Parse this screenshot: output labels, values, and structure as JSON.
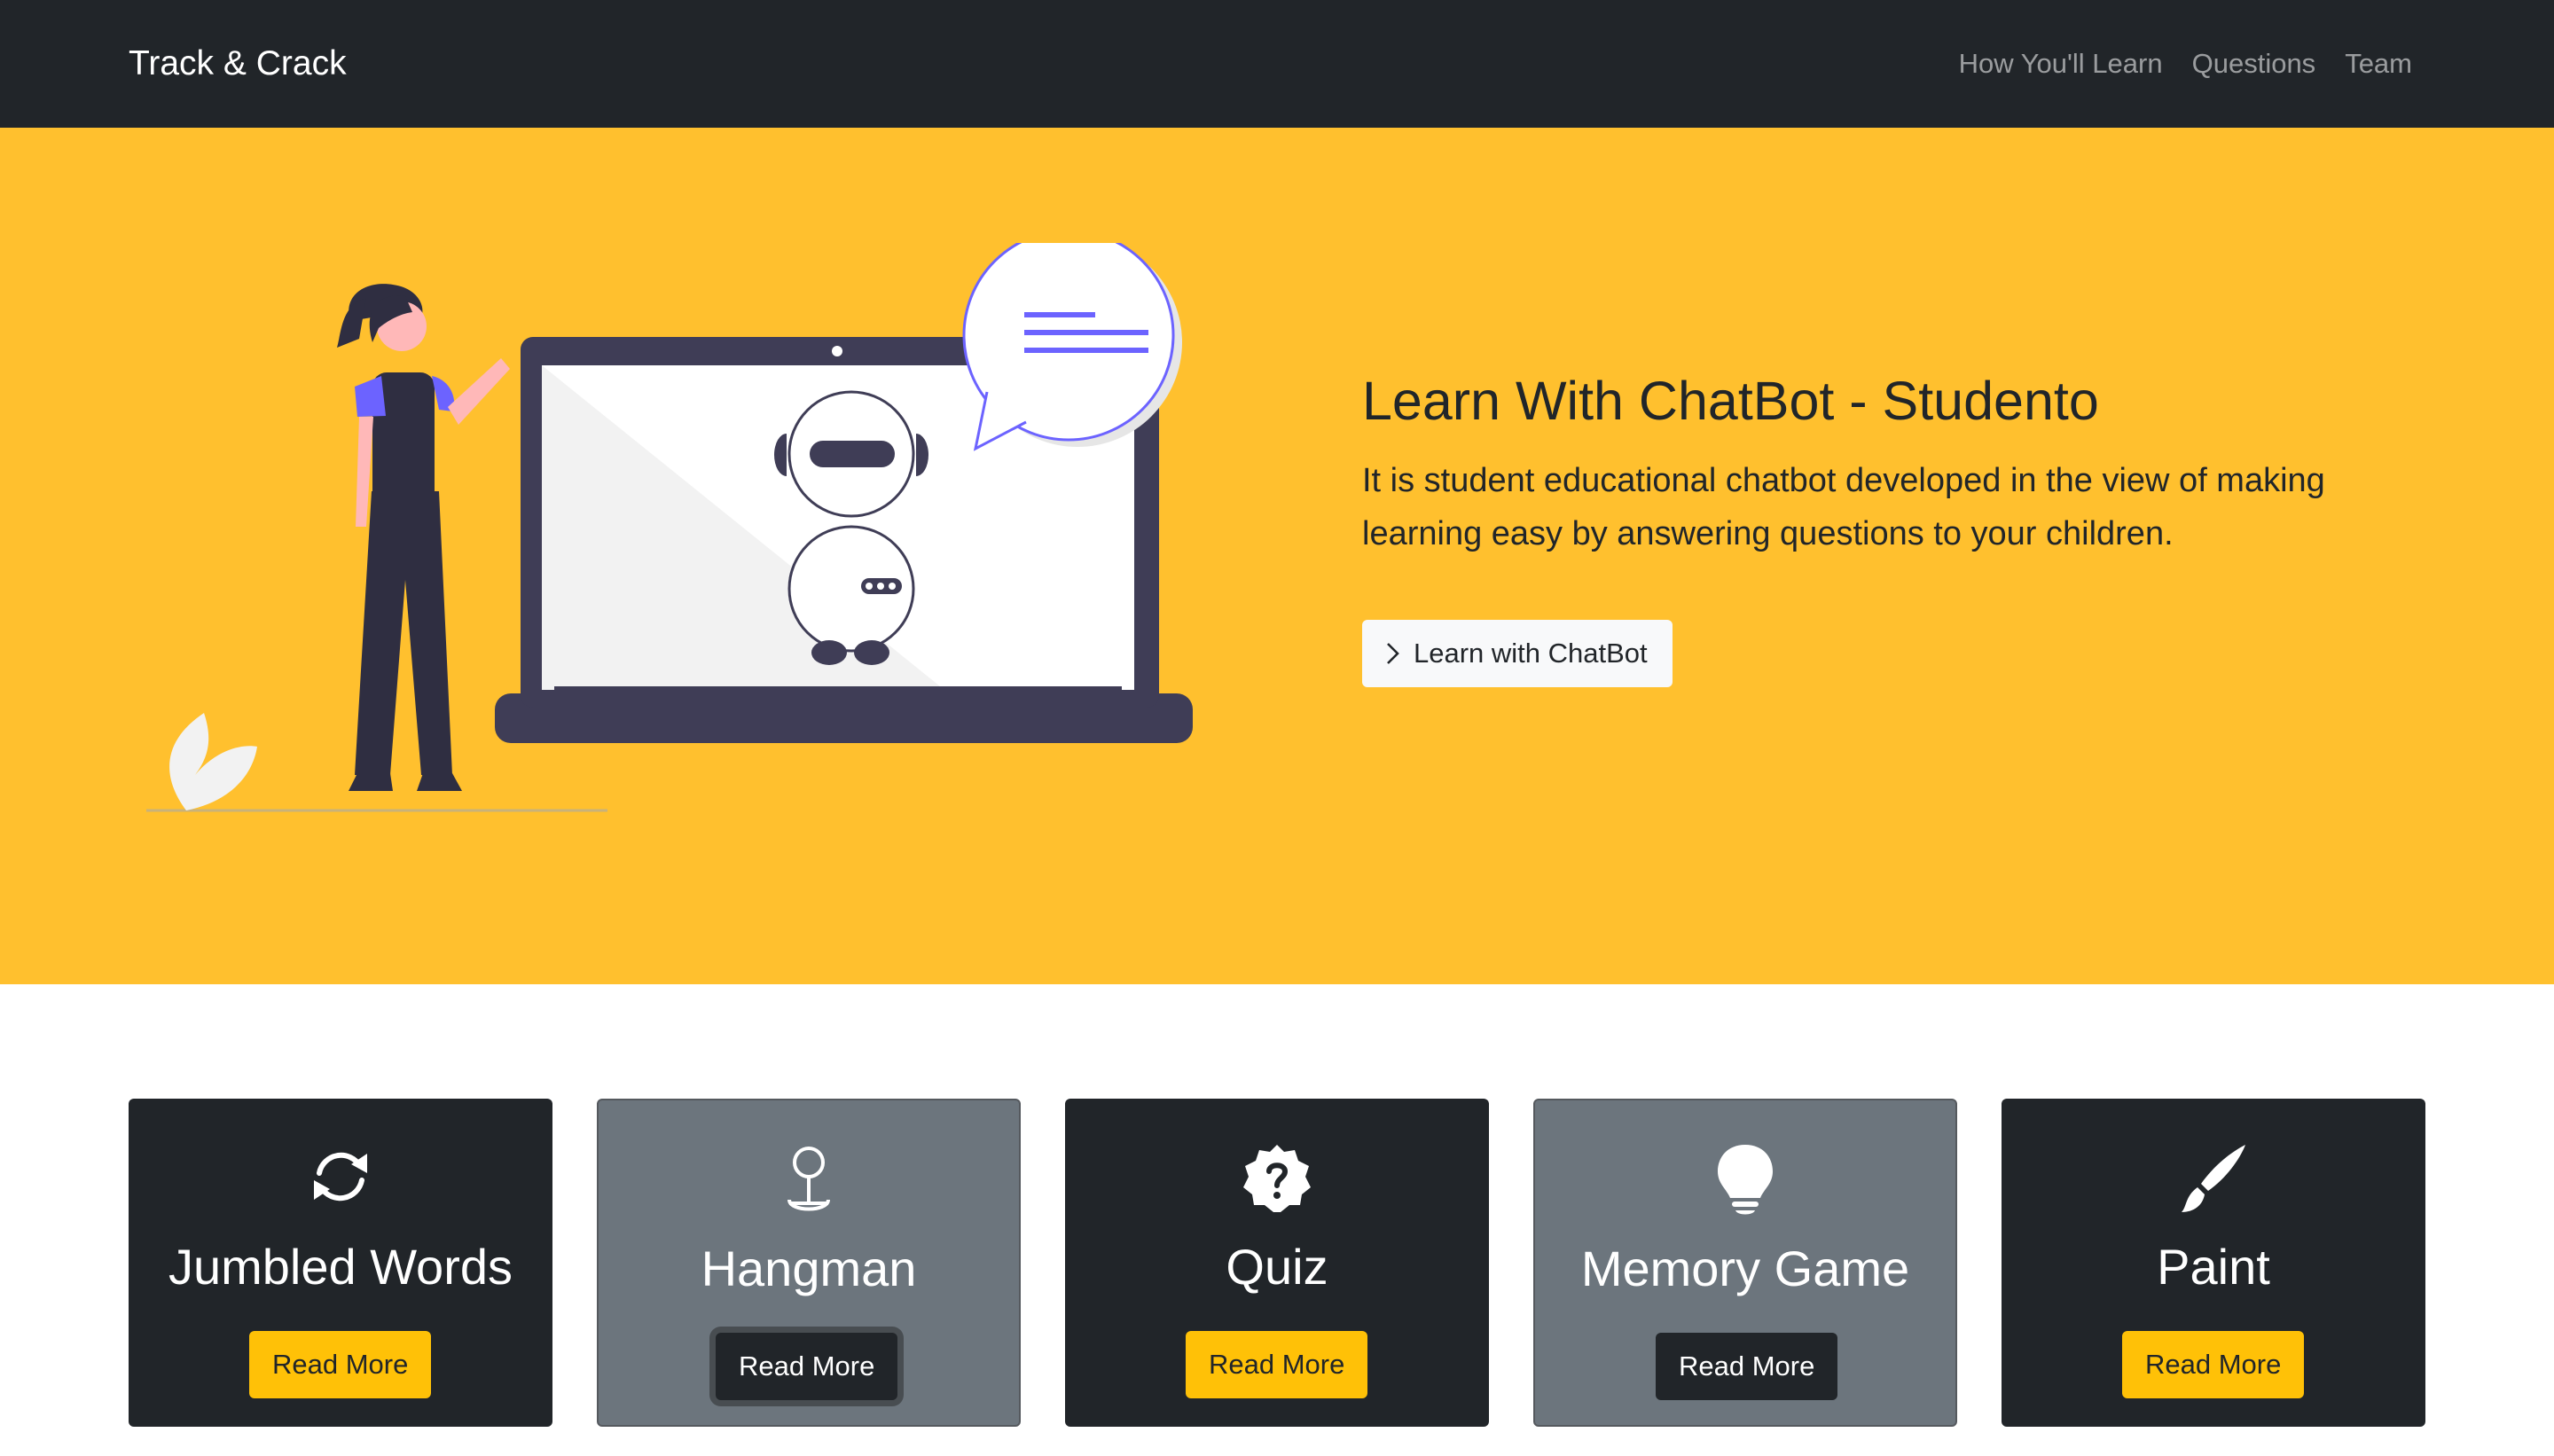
{
  "navbar": {
    "brand": "Track & Crack",
    "links": [
      "How You'll Learn",
      "Questions",
      "Team"
    ]
  },
  "hero": {
    "title": "Learn With ChatBot - Studento",
    "lead": "It is student educational chatbot developed in the view of making learning easy by answering questions to your children.",
    "button_label": "Learn with ChatBot",
    "background_color": "#ffc02e"
  },
  "cards": [
    {
      "title": "Jumbled Words",
      "button_label": "Read More",
      "icon": "refresh-icon",
      "theme": "dark",
      "button_style": "yellow"
    },
    {
      "title": "Hangman",
      "button_label": "Read More",
      "icon": "pin-icon",
      "theme": "gray",
      "button_style": "black"
    },
    {
      "title": "Quiz",
      "button_label": "Read More",
      "icon": "question-badge-icon",
      "theme": "dark",
      "button_style": "yellow"
    },
    {
      "title": "Memory Game",
      "button_label": "Read More",
      "icon": "lightbulb-icon",
      "theme": "gray",
      "button_style": "black"
    },
    {
      "title": "Paint",
      "button_label": "Read More",
      "icon": "brush-icon",
      "theme": "dark",
      "button_style": "yellow"
    }
  ],
  "colors": {
    "navbar": "#212529",
    "accent": "#ffc107",
    "card_dark": "#212529",
    "card_gray": "#6c757d",
    "illustration_purple": "#6c63ff"
  }
}
